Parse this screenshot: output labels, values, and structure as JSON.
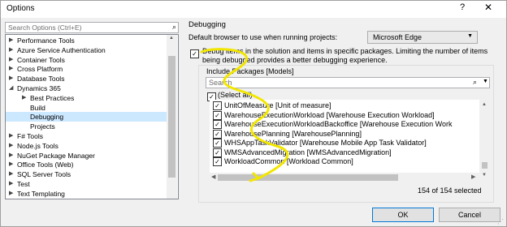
{
  "window": {
    "title": "Options",
    "help": "?",
    "close": "✕"
  },
  "search": {
    "placeholder": "Search Options (Ctrl+E)"
  },
  "tree": [
    {
      "label": "Performance Tools",
      "arrow": "▶"
    },
    {
      "label": "Azure Service Authentication",
      "arrow": "▶"
    },
    {
      "label": "Container Tools",
      "arrow": "▶"
    },
    {
      "label": "Cross Platform",
      "arrow": "▶"
    },
    {
      "label": "Database Tools",
      "arrow": "▶"
    },
    {
      "label": "Dynamics 365",
      "arrow": "◢"
    },
    {
      "label": "Best Practices",
      "arrow": "▶"
    },
    {
      "label": "Build",
      "arrow": ""
    },
    {
      "label": "Debugging",
      "arrow": ""
    },
    {
      "label": "Projects",
      "arrow": ""
    },
    {
      "label": "F# Tools",
      "arrow": "▶"
    },
    {
      "label": "Node.js Tools",
      "arrow": "▶"
    },
    {
      "label": "NuGet Package Manager",
      "arrow": "▶"
    },
    {
      "label": "Office Tools (Web)",
      "arrow": "▶"
    },
    {
      "label": "SQL Server Tools",
      "arrow": "▶"
    },
    {
      "label": "Test",
      "arrow": "▶"
    },
    {
      "label": "Text Templating",
      "arrow": "▶"
    }
  ],
  "panel": {
    "section_title": "Debugging",
    "browser_label": "Default browser to use when running projects:",
    "browser_value": "Microsoft Edge",
    "debug_text": "Debug items in the solution and items in specific packages. Limiting the number of items being debugged provides a better debugging experience.",
    "include_label": "Include Packages [Models]",
    "pkg_search_placeholder": "Search",
    "select_all": "(Select all)",
    "packages": [
      "UnitOfMeasure [Unit of measure]",
      "WarehouseExecutionWorkload [Warehouse Execution Workload]",
      "WarehouseExecutionWorkloadBackoffice [Warehouse Execution Work",
      "WarehousePlanning [WarehousePlanning]",
      "WHSAppTaskValidator [Warehouse Mobile App Task Validator]",
      "WMSAdvancedMigration [WMSAdvancedMigration]",
      "WorkloadCommon [Workload Common]"
    ],
    "count": "154 of 154 selected"
  },
  "buttons": {
    "ok": "OK",
    "cancel": "Cancel"
  },
  "colors": {
    "highlight": "#f2e600",
    "selection": "#cce8ff"
  },
  "icons": {
    "search": "search-icon",
    "dropdown": "chevron-down-icon"
  }
}
